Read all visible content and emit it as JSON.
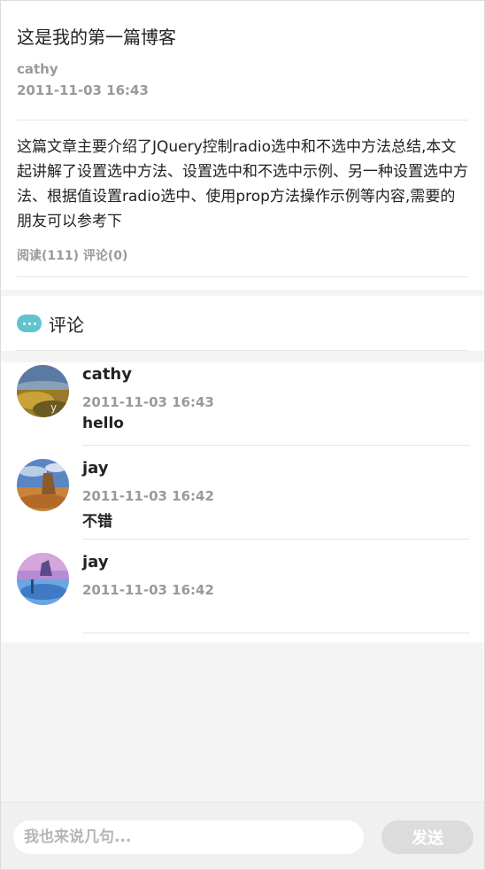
{
  "post": {
    "title": "这是我的第一篇博客",
    "author": "cathy",
    "date": "2011-11-03 16:43",
    "body": "这篇文章主要介绍了JQuery控制radio选中和不选中方法总结,本文起讲解了设置选中方法、设置选中和不选中示例、另一种设置选中方法、根据值设置radio选中、使用prop方法操作示例等内容,需要的朋友可以参考下",
    "stats": "阅读(111) 评论(0)"
  },
  "comments": {
    "title": "评论",
    "icon": "chat-bubble-icon",
    "items": [
      {
        "name": "cathy",
        "date": "2011-11-03 16:43",
        "text": "hello",
        "avatar": "avatar-landscape-field"
      },
      {
        "name": "jay",
        "date": "2011-11-03 16:42",
        "text": "不错",
        "avatar": "avatar-desert-rock"
      },
      {
        "name": "jay",
        "date": "2011-11-03 16:42",
        "text": "",
        "avatar": "avatar-purple-sky"
      }
    ]
  },
  "footer": {
    "placeholder": "我也来说几句...",
    "send_label": "发送"
  },
  "colors": {
    "accent": "#5fc4d0",
    "muted_text": "#9a9a9a",
    "send_button": "#dcdcdc"
  }
}
